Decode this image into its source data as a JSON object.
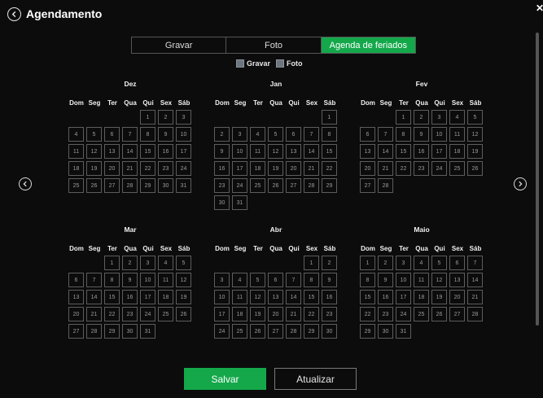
{
  "header": {
    "title": "Agendamento"
  },
  "tabs": [
    {
      "label": "Gravar",
      "active": false
    },
    {
      "label": "Foto",
      "active": false
    },
    {
      "label": "Agenda de feriados",
      "active": true
    }
  ],
  "legend": {
    "record_label": "Gravar",
    "photo_label": "Foto"
  },
  "weekdays": [
    "Dom",
    "Seg",
    "Ter",
    "Qua",
    "Qui",
    "Sex",
    "Sáb"
  ],
  "months": [
    {
      "name": "Dez",
      "start": 4,
      "days": 31
    },
    {
      "name": "Jan",
      "start": 6,
      "days": 31
    },
    {
      "name": "Fev",
      "start": 2,
      "days": 28
    },
    {
      "name": "Mar",
      "start": 2,
      "days": 31
    },
    {
      "name": "Abr",
      "start": 5,
      "days": 30
    },
    {
      "name": "Maio",
      "start": 0,
      "days": 31
    }
  ],
  "buttons": {
    "save_label": "Salvar",
    "update_label": "Atualizar"
  },
  "colors": {
    "accent": "#14a84b",
    "background": "#0c0c0c",
    "cell_border": "#5d5d5d",
    "legend_swatch": "#6d7680"
  },
  "icons": {
    "back": "chevron-left-circle-icon",
    "close": "close-icon",
    "prev": "chevron-left-circle-icon",
    "next": "chevron-right-circle-icon"
  }
}
